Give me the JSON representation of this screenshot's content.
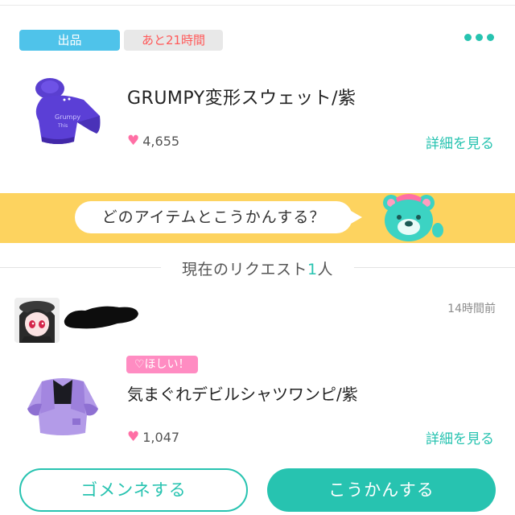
{
  "listing": {
    "status_tag": "出品",
    "time_tag": "あと21時間",
    "item_title": "GRUMPY変形スウェット/紫",
    "likes": "4,655",
    "detail_link": "詳細を見る"
  },
  "banner": {
    "prompt": "どのアイテムとこうかんする？"
  },
  "requests": {
    "label_prefix": "現在のリクエスト",
    "count": "1",
    "label_suffix": "人",
    "items": [
      {
        "timestamp": "14時間前",
        "badge": "♡ほしい！",
        "item_title": "気まぐれデビルシャツワンピ/紫",
        "likes": "1,047",
        "detail_link": "詳細を見る"
      }
    ]
  },
  "actions": {
    "decline_label": "ゴメンネする",
    "exchange_label": "こうかんする"
  },
  "colors": {
    "accent": "#27c3b0",
    "listing_tag": "#4fc3ea",
    "banner": "#fdd35f",
    "heart": "#ff6fa5",
    "time_text": "#ff5a5a"
  },
  "icons": [
    "more-icon",
    "heart-icon",
    "bear-mascot-icon"
  ]
}
